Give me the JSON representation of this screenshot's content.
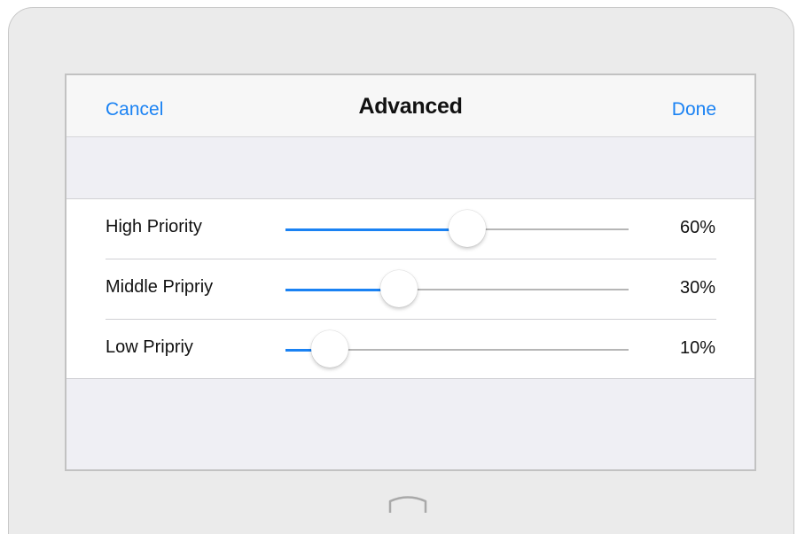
{
  "navbar": {
    "cancel_label": "Cancel",
    "title": "Advanced",
    "done_label": "Done"
  },
  "priorities": [
    {
      "label": "High Priority",
      "value_text": "60%",
      "level": 0.53
    },
    {
      "label": "Middle Pripriy",
      "value_text": "30%",
      "level": 0.33
    },
    {
      "label": "Low Pripriy",
      "value_text": "10%",
      "level": 0.13
    }
  ],
  "colors": {
    "accent": "#1a82f3",
    "track": "#b6b6b6",
    "background": "#efeff4",
    "device_frame": "#ebebeb"
  },
  "icons": {
    "home": "home-button-icon"
  }
}
